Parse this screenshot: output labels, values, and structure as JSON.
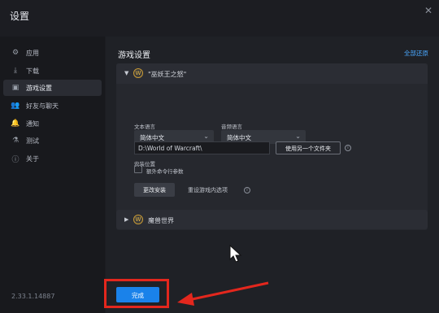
{
  "window": {
    "title": "设置",
    "close_glyph": "✕"
  },
  "sidebar": {
    "items": [
      {
        "label": "应用",
        "icon": "gear-icon",
        "glyph": "⚙"
      },
      {
        "label": "下载",
        "icon": "download-icon",
        "glyph": "⤓"
      },
      {
        "label": "游戏设置",
        "icon": "gamepad-icon",
        "glyph": "▣"
      },
      {
        "label": "好友与聊天",
        "icon": "friends-icon",
        "glyph": "👥"
      },
      {
        "label": "通知",
        "icon": "bell-icon",
        "glyph": "🔔"
      },
      {
        "label": "测试",
        "icon": "flask-icon",
        "glyph": "⚗"
      },
      {
        "label": "关于",
        "icon": "info-icon",
        "glyph": "ⓘ"
      }
    ],
    "active_index": 2,
    "version": "2.33.1.14887"
  },
  "main": {
    "section_title": "游戏设置",
    "reset_link": "全部还原",
    "game1": {
      "name": "\"巫妖王之怒\"",
      "icon_glyph": "W",
      "text_language_label": "文本语言",
      "text_language_value": "简体中文",
      "audio_language_label": "音频语言",
      "audio_language_value": "简体中文",
      "install_location_label": "安装位置",
      "install_location_value": "D:\\World of Warcraft\\",
      "use_other_folder_button": "使用另一个文件夹",
      "extra_cmd_label": "额外命令行参数",
      "extra_cmd_checked": false,
      "change_install_button": "更改安装",
      "reset_ingame_options": "重设游戏内选项"
    },
    "game2": {
      "name": "魔兽世界",
      "icon_glyph": "W"
    }
  },
  "footer": {
    "done_button": "完成"
  },
  "colors": {
    "accent": "#1a82ea",
    "annotation": "#e3271d",
    "link": "#4aa8ff"
  }
}
